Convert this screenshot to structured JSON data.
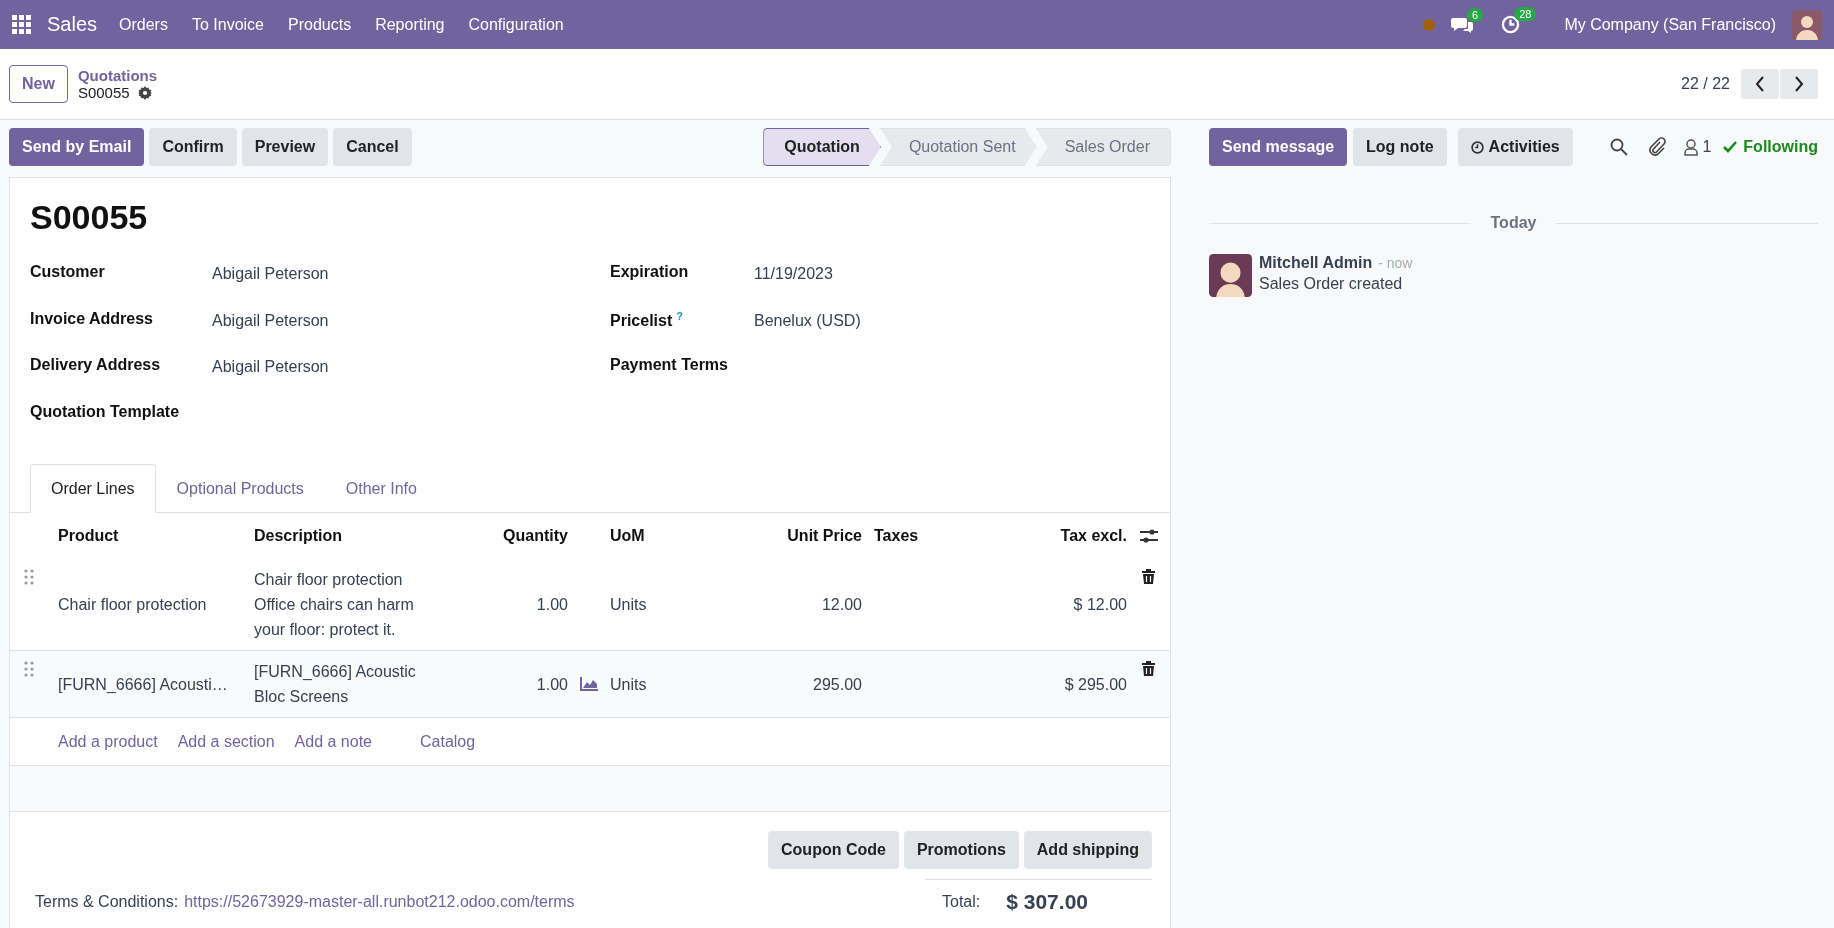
{
  "navbar": {
    "app_name": "Sales",
    "menus": [
      "Orders",
      "To Invoice",
      "Products",
      "Reporting",
      "Configuration"
    ],
    "messages_count": "6",
    "activities_count": "28",
    "company": "My Company (San Francisco)"
  },
  "control_panel": {
    "new_button": "New",
    "breadcrumb": "Quotations",
    "record": "S00055",
    "pager": "22 / 22"
  },
  "actions": [
    {
      "label": "Send by Email",
      "kind": "primary"
    },
    {
      "label": "Confirm",
      "kind": "secondary"
    },
    {
      "label": "Preview",
      "kind": "secondary"
    },
    {
      "label": "Cancel",
      "kind": "secondary"
    }
  ],
  "stages": [
    {
      "label": "Quotation",
      "selected": true
    },
    {
      "label": "Quotation Sent",
      "selected": false
    },
    {
      "label": "Sales Order",
      "selected": false
    }
  ],
  "form": {
    "title": "S00055",
    "fields_left": [
      {
        "label": "Customer",
        "value": "Abigail Peterson"
      },
      {
        "label": "Invoice Address",
        "value": "Abigail Peterson"
      },
      {
        "label": "Delivery Address",
        "value": "Abigail Peterson"
      },
      {
        "label": "Quotation Template"
      }
    ],
    "fields_right": [
      {
        "label": "Expiration",
        "value": "11/19/2023"
      },
      {
        "label": "Pricelist",
        "help": "?",
        "value": "Benelux (USD)"
      },
      {
        "label": "Payment Terms"
      }
    ]
  },
  "tabs": [
    {
      "label": "Order Lines",
      "selected": true
    },
    {
      "label": "Optional Products",
      "selected": false
    },
    {
      "label": "Other Info",
      "selected": false
    }
  ],
  "table": {
    "columns": [
      "Product",
      "Description",
      "Quantity",
      "UoM",
      "Unit Price",
      "Taxes",
      "Tax excl."
    ],
    "rows": [
      {
        "product": "Chair floor protection",
        "description": "Chair floor protection\nOffice chairs can harm your floor: protect it.",
        "quantity": "1.00",
        "forecast": false,
        "uom": "Units",
        "unit_price": "12.00",
        "subtotal": "$ 12.00"
      },
      {
        "product": "[FURN_6666] Acousti…",
        "description": "[FURN_6666] Acoustic Bloc Screens",
        "quantity": "1.00",
        "forecast": true,
        "uom": "Units",
        "unit_price": "295.00",
        "subtotal": "$ 295.00"
      }
    ],
    "add_links": [
      "Add a product",
      "Add a section",
      "Add a note",
      "Catalog"
    ]
  },
  "footer_buttons": [
    "Coupon Code",
    "Promotions",
    "Add shipping"
  ],
  "terms": {
    "label": "Terms & Conditions:",
    "link": "https://52673929-master-all.runbot212.odoo.com/terms"
  },
  "total": {
    "label": "Total:",
    "value": "$ 307.00"
  },
  "chatter": {
    "buttons": [
      {
        "label": "Send message",
        "kind": "primary"
      },
      {
        "label": "Log note",
        "kind": "secondary"
      },
      {
        "label": "Activities",
        "kind": "activities"
      }
    ],
    "followers_count": "1",
    "following": "Following",
    "date": "Today",
    "messages": [
      {
        "author": "Mitchell Admin",
        "time": "- now",
        "body": "Sales Order created"
      }
    ]
  }
}
